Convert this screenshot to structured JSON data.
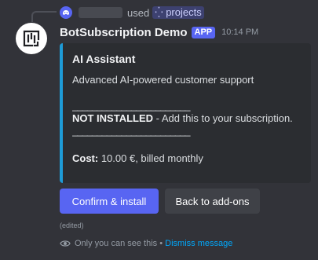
{
  "reply": {
    "used_text": "used",
    "command_name": "projects"
  },
  "message": {
    "username": "BotSubscription Demo",
    "app_tag": "APP",
    "timestamp": "10:14 PM"
  },
  "embed": {
    "accent_color": "#1e9bd7",
    "title": "AI Assistant",
    "description": "Advanced AI-powered customer support",
    "rule": "________________________",
    "status_label": "NOT INSTALLED",
    "status_text": " - Add this to your subscription.",
    "cost_label": "Cost:",
    "cost_value": " 10.00 €, billed monthly"
  },
  "buttons": {
    "confirm_label": "Confirm & install",
    "back_label": "Back to add-ons"
  },
  "footer": {
    "edited": "(edited)",
    "only_you": "Only you can see this",
    "separator": " • ",
    "dismiss": "Dismiss message"
  },
  "colors": {
    "background": "#323339",
    "primary_button": "#5865f2",
    "secondary_button": "#3f4147",
    "link": "#00a8fc"
  }
}
